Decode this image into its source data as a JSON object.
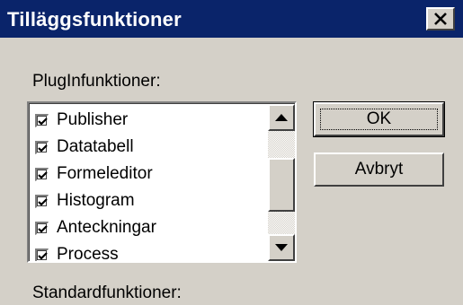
{
  "window": {
    "title": "Tilläggsfunktioner"
  },
  "labels": {
    "plugin_section": "PlugInfunktioner:",
    "standard_section": "Standardfunktioner:"
  },
  "plugin_list": {
    "items": [
      {
        "label": "Publisher",
        "checked": true
      },
      {
        "label": "Datatabell",
        "checked": true
      },
      {
        "label": "Formeleditor",
        "checked": true
      },
      {
        "label": "Histogram",
        "checked": true
      },
      {
        "label": "Anteckningar",
        "checked": true
      },
      {
        "label": "Process",
        "checked": true
      }
    ]
  },
  "buttons": {
    "ok": "OK",
    "cancel": "Avbryt"
  },
  "icons": {
    "close": "close-icon",
    "scroll_up": "arrow-up-icon",
    "scroll_down": "arrow-down-icon",
    "check": "check-icon"
  },
  "colors": {
    "titlebar": "#0a246a",
    "face": "#d4d0c8",
    "list_bg": "#ffffff"
  }
}
